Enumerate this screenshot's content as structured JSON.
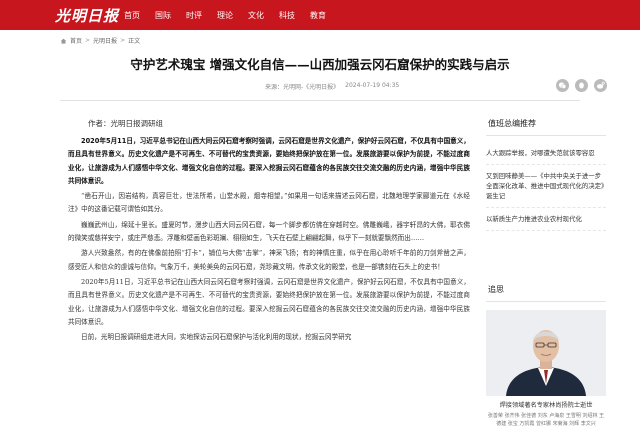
{
  "site": {
    "logo_text": "光明日报",
    "nav": [
      "首页",
      "国际",
      "时评",
      "理论",
      "文化",
      "科技",
      "教育"
    ]
  },
  "breadcrumb": [
    "首页",
    "光明日报",
    "正文"
  ],
  "article": {
    "title": "守护艺术瑰宝 增强文化自信——山西加强云冈石窟保护的实践与启示",
    "source": "来源：光明网-《光明日报》",
    "date": "2024-07-19 04:35",
    "author": "作者：光明日报调研组",
    "paragraphs": [
      {
        "style": "bold",
        "text": "2020年5月11日，习近平总书记在山西大同云冈石窟考察时强调，云冈石窟是世界文化遗产，保护好云冈石窟，不仅具有中国意义，而且具有世界意义。历史文化遗产是不可再生、不可替代的宝贵资源，要始终把保护放在第一位。发展旅游要以保护为前提，不能过度商业化，让旅游成为人们感悟中华文化、增强文化自信的过程。要深入挖掘云冈石窟蕴含的各民族交往交流交融的历史内涵，增强中华民族共同体意识。"
      },
      {
        "style": "serif",
        "text": "“凿石开山，因岩结构，真容巨壮，世法所希，山堂水殿，烟寺相望。”如果用一句话来描述云冈石窟，北魏地理学家郦道元在《水经注》中的这番记载可谓恰如其分。"
      },
      {
        "style": "serif",
        "text": "巍巍武州山，绵延十里长。盛夏时节，漫步山西大同云冈石窟，每一个脚步都仿佛在穿越时空。佛雕巍峨，器宇轩昂的大佛，耶衣佛的微笑或慈祥安宁，或庄严慈悲。浮雕和壁画色彩斑斓、栩栩如生，飞天在石壁上翩翩起舞，似乎下一刻就要飘然而出……"
      },
      {
        "style": "serif",
        "text": "游人兴致盎然，有的在佛像前拍照“打卡”，铺位与大佛“击掌”，神采飞扬；有的神情庄重，似乎在用心聆听千年前的刀剑斧凿之声，感受匠人和信众的虔诚与信仰。气象万千，美轮美奂的云冈石窟，尧珍藏文明，传承文化的殿堂，也是一部镌刻在石头上的史书！"
      },
      {
        "style": "serif",
        "text": "2020年5月11日，习近平总书记在山西大同云冈石窟考察时强调，云冈石窟是世界文化遗产，保护好云冈石窟，不仅具有中国意义，而且具有世界意义。历史文化遗产是不可再生、不可替代的宝贵资源，要始终把保护放在第一位。发展旅游要以保护为前提，不能过度商业化，让旅游成为人们感悟中华文化、增强文化自信的过程。要深入挖掘云冈石窟蕴含的各民族交往交流交融的历史内涵，增强中华民族共同体意识。"
      },
      {
        "style": "serif",
        "text": "日前，光明日报调研组走进大同，实地探访云冈石窟保护与活化利用的现状，挖掘云冈学研究"
      }
    ]
  },
  "sidebar": {
    "recommend_title": "值班总编推荐",
    "recommend_items": [
      "人大跟踪举报，对哪遭失范就该零容忍",
      "又到回味静美——《中共中央关于进一步全面深化改革、推进中国式现代化的决定》诞生记",
      "以新质生产力推进农业农村现代化"
    ],
    "memorial_title": "追思",
    "memorial_caption": "焊接领域著名专家林尚扬院士逝世",
    "memorial_names": "张善荣 张齐伟 张佳德 刘东 卢海泉 王雪明 刘绍林 王德建 张宝 万凯霞 曾红娜 宋菊海 刘辉 李文兴"
  },
  "colors": {
    "brand_red": "#c8161e"
  }
}
